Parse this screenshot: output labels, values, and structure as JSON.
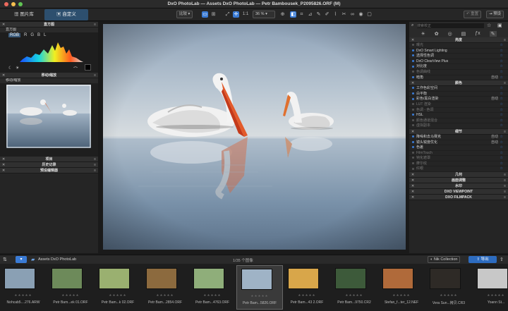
{
  "window": {
    "title": "DxO PhotoLab — Assets DxO PhotoLab — Petr Bambousek_P2095826.ORF (M)"
  },
  "toolbar": {
    "tab_library": "图片库",
    "tab_customize": "自定义",
    "compare_label": "比较",
    "ratio_label": "1:1",
    "zoom_value": "36 %",
    "reset_label": "重置",
    "preset_label": "预设"
  },
  "left": {
    "histogram_header": "直方图",
    "histogram_sub": "直方图",
    "channels": [
      "RGB",
      "R",
      "G",
      "B",
      "L"
    ],
    "move_zoom_header": "移动/缩放",
    "move_zoom_sub": "移动/缩放",
    "project_header": "项目",
    "history_header": "历史记录",
    "preset_editor_header": "预设编辑器"
  },
  "right": {
    "search_placeholder": "搜索校正",
    "brightness_header": "亮度",
    "brightness_items": [
      {
        "label": "曝光",
        "active": false,
        "auto": ""
      },
      {
        "label": "DxO Smart Lighting",
        "active": true,
        "auto": ""
      },
      {
        "label": "选择性色调",
        "active": true,
        "auto": ""
      },
      {
        "label": "DxO ClearView Plus",
        "active": true,
        "auto": ""
      },
      {
        "label": "对比度",
        "active": true,
        "auto": ""
      },
      {
        "label": "色调曲线",
        "active": false,
        "auto": ""
      },
      {
        "label": "暗角",
        "active": true,
        "auto": "自动"
      }
    ],
    "color_header": "颜色",
    "color_items": [
      {
        "label": "工作色彩空间",
        "active": true,
        "auto": ""
      },
      {
        "label": "白平衡",
        "active": true,
        "auto": ""
      },
      {
        "label": "彩色/黑白渲染",
        "active": true,
        "auto": "自动"
      },
      {
        "label": "LUT 渲染",
        "active": false,
        "auto": ""
      },
      {
        "label": "色调 - 色调",
        "active": false,
        "auto": ""
      },
      {
        "label": "HSL",
        "active": true,
        "auto": ""
      },
      {
        "label": "颜色通道混合",
        "active": false,
        "auto": ""
      },
      {
        "label": "虚拟副本",
        "active": false,
        "auto": ""
      }
    ],
    "detail_header": "细节",
    "detail_items": [
      {
        "label": "降噪和去马赛克",
        "active": true,
        "auto": "自动"
      },
      {
        "label": "镜头锐度优化",
        "active": true,
        "auto": "自动"
      },
      {
        "label": "色差",
        "active": true,
        "auto": ""
      },
      {
        "label": "FilmTouch",
        "active": false,
        "auto": ""
      },
      {
        "label": "钝化遮罩",
        "active": false,
        "auto": ""
      },
      {
        "label": "摩尔纹",
        "active": false,
        "auto": ""
      },
      {
        "label": "红眼",
        "active": false,
        "auto": ""
      }
    ],
    "geometry_header": "几何",
    "watermark_header": "画面调整",
    "local_header": "水印",
    "viewpoint_header": "DXO VIEWPOINT",
    "filmpack_header": "DXO FILMPACK"
  },
  "filmbar": {
    "folder": "Assets DxO PhotoLab",
    "count": "1/35 个图像",
    "nik": "Nik Collection",
    "export": "导出"
  },
  "thumbnails": [
    {
      "name": "Nohcab5....276.ARW",
      "color": "#8aa0b4"
    },
    {
      "name": "Petr Bam...ek 01.ORF",
      "color": "#6d8a5a"
    },
    {
      "name": "Petr Bam...k 02.ORF",
      "color": "#9ab070"
    },
    {
      "name": "Petr Bam...2854.ORF",
      "color": "#8c6a3e"
    },
    {
      "name": "Petr Bam...4763.ORF",
      "color": "#8fae7a"
    },
    {
      "name": "Petr Bam...5826.ORF",
      "color": "#9fb3c6"
    },
    {
      "name": "Petr Bam...43 2.ORF",
      "color": "#d8a64a"
    },
    {
      "name": "Petr Bam...9750.CR2",
      "color": "#3d5a3a"
    },
    {
      "name": "Stefan_f...ter_12.NEF",
      "color": "#b06a3a"
    },
    {
      "name": "Vera Sun...拷贝.CR3",
      "color": "#2e2a26"
    },
    {
      "name": "Yoann St...",
      "color": "#c8c8c8"
    }
  ],
  "accent_color": "#3a7bd5"
}
